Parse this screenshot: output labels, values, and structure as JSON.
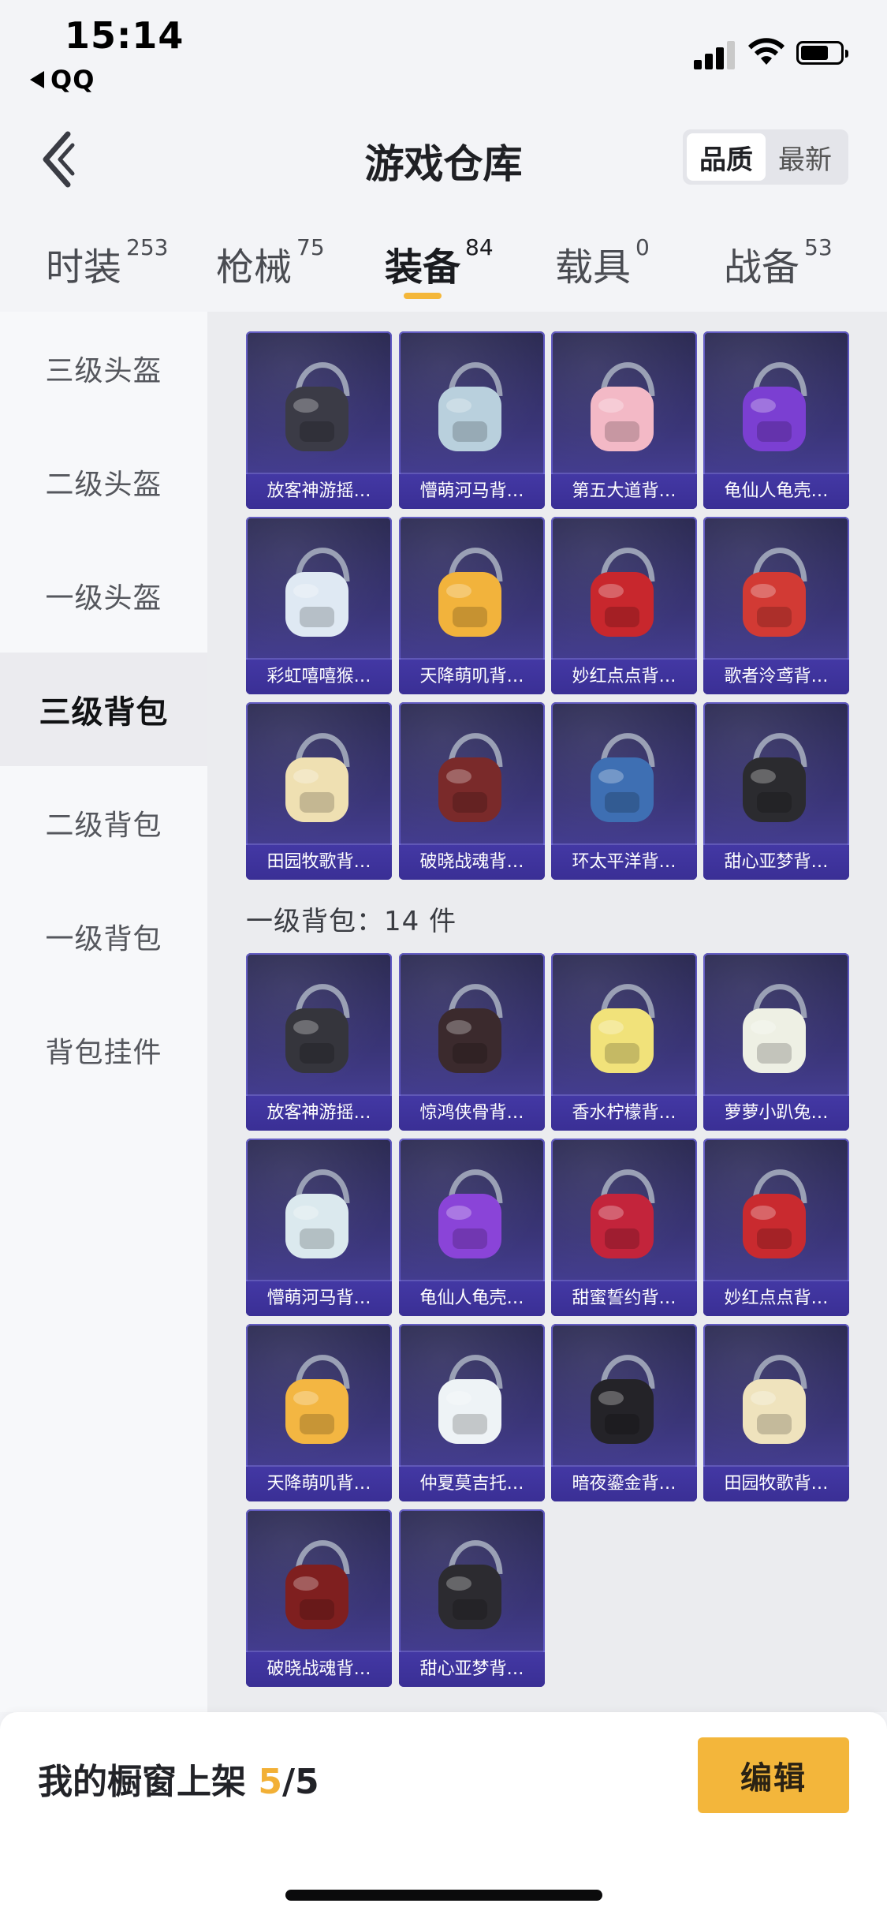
{
  "status_bar": {
    "time": "15:14",
    "back_app": "QQ"
  },
  "header": {
    "title": "游戏仓库",
    "sort_options": [
      "品质",
      "最新"
    ],
    "active_sort": "品质"
  },
  "tabs": [
    {
      "label": "时装",
      "count": "253"
    },
    {
      "label": "枪械",
      "count": "75"
    },
    {
      "label": "装备",
      "count": "84",
      "active": true
    },
    {
      "label": "载具",
      "count": "0"
    },
    {
      "label": "战备",
      "count": "53"
    }
  ],
  "sidebar": {
    "items": [
      "三级头盔",
      "二级头盔",
      "一级头盔",
      "三级背包",
      "二级背包",
      "一级背包",
      "背包挂件"
    ],
    "active": "三级背包"
  },
  "grid": {
    "top_items": [
      {
        "label": "放客神游摇…",
        "icon": "speaker-bear-backpack-icon",
        "color": "#3b3b46"
      },
      {
        "label": "懵萌河马背…",
        "icon": "hippo-backpack-icon",
        "color": "#b9d0dd"
      },
      {
        "label": "第五大道背…",
        "icon": "quilted-bag-icon",
        "color": "#f3b9c6"
      },
      {
        "label": "龟仙人龟壳…",
        "icon": "turtle-shell-backpack-icon",
        "color": "#7b3fd2"
      },
      {
        "label": "彩虹嘻嘻猴…",
        "icon": "rainbow-bag-icon",
        "color": "#dfe9f3"
      },
      {
        "label": "天降萌叽背…",
        "icon": "yellow-backpack-icon",
        "color": "#f2b33c"
      },
      {
        "label": "妙红点点背…",
        "icon": "ladybug-bag-icon",
        "color": "#c8272d"
      },
      {
        "label": "歌者泠鸢背…",
        "icon": "red-pouch-bag-icon",
        "color": "#d23a34"
      },
      {
        "label": "田园牧歌背…",
        "icon": "basket-bag-icon",
        "color": "#efe0b2"
      },
      {
        "label": "破晓战魂背…",
        "icon": "armor-backpack-icon",
        "color": "#7a2a2a"
      },
      {
        "label": "环太平洋背…",
        "icon": "mech-backpack-icon",
        "color": "#3e6fb3"
      },
      {
        "label": "甜心亚梦背…",
        "icon": "cat-ear-bag-icon",
        "color": "#2b2b2f"
      }
    ],
    "section_title": "一级背包：14 件",
    "bottom_items": [
      {
        "label": "放客神游摇…",
        "icon": "speaker-bear-backpack-icon",
        "color": "#35353c"
      },
      {
        "label": "惊鸿侠骨背…",
        "icon": "dark-backpack-icon",
        "color": "#3b2a2d"
      },
      {
        "label": "香水柠檬背…",
        "icon": "lemon-backpack-icon",
        "color": "#f1e27a"
      },
      {
        "label": "萝萝小趴兔…",
        "icon": "bunny-bag-icon",
        "color": "#eef0e4"
      },
      {
        "label": "懵萌河马背…",
        "icon": "hippo-backpack-icon",
        "color": "#dbe9ee"
      },
      {
        "label": "龟仙人龟壳…",
        "icon": "turtle-shell-backpack-icon",
        "color": "#8a44d8"
      },
      {
        "label": "甜蜜誓约背…",
        "icon": "heart-bag-icon",
        "color": "#c3243b"
      },
      {
        "label": "妙红点点背…",
        "icon": "ladybug-bag-icon",
        "color": "#c92a2f"
      },
      {
        "label": "天降萌叽背…",
        "icon": "yellow-backpack-icon",
        "color": "#f3b642"
      },
      {
        "label": "仲夏莫吉托…",
        "icon": "mojito-bag-icon",
        "color": "#eef3f6"
      },
      {
        "label": "暗夜鎏金背…",
        "icon": "gold-black-bag-icon",
        "color": "#242328"
      },
      {
        "label": "田园牧歌背…",
        "icon": "basket-bag-icon",
        "color": "#efe3bd"
      },
      {
        "label": "破晓战魂背…",
        "icon": "armor-backpack-icon",
        "color": "#7f1f1f"
      },
      {
        "label": "甜心亚梦背…",
        "icon": "cat-ear-bag-icon",
        "color": "#2c2b30"
      }
    ]
  },
  "footer": {
    "showcase_label": "我的橱窗上架",
    "showcase_current": "5",
    "showcase_total": "/5",
    "edit_label": "编辑"
  }
}
